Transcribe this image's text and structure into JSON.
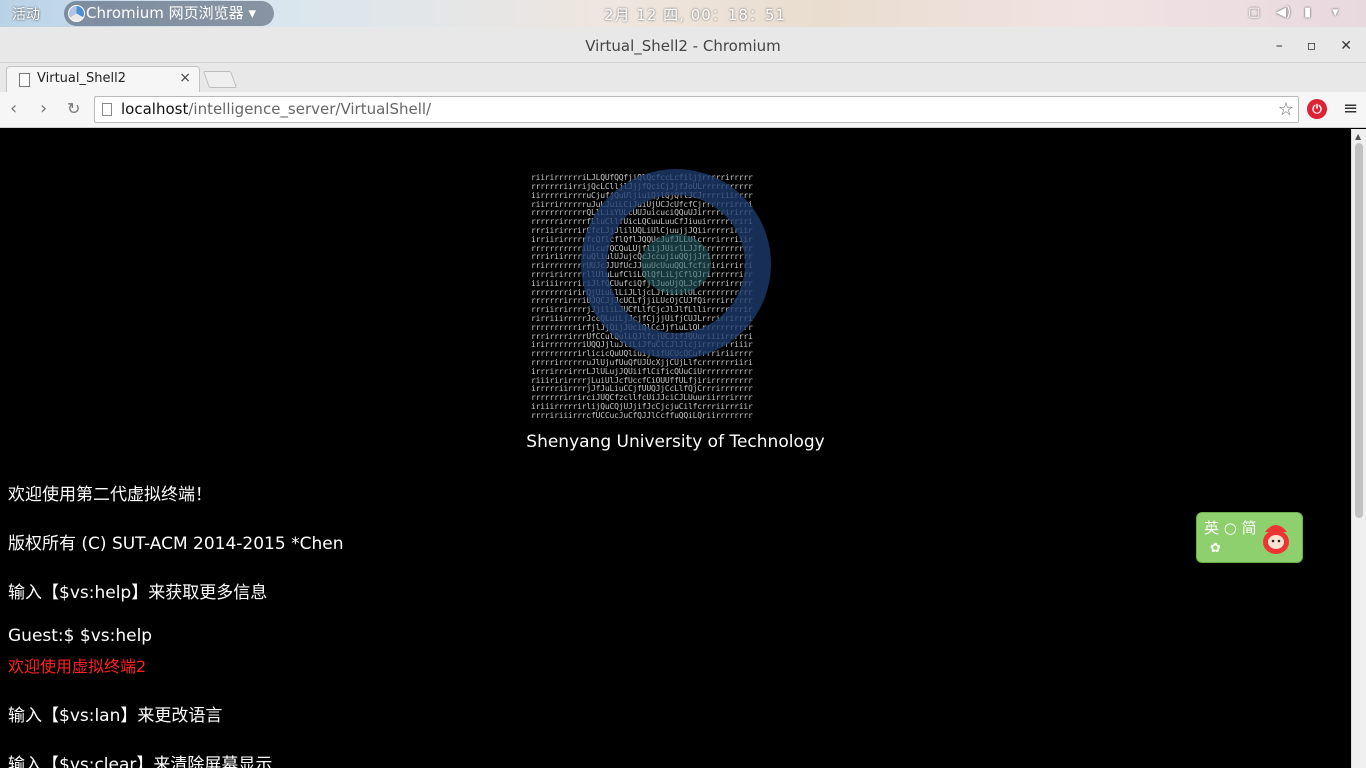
{
  "system_bar": {
    "activities": "活动",
    "app_menu": "Chromium 网页浏览器",
    "clock": "2月 12 四, 00：18：51"
  },
  "window": {
    "title": "Virtual_Shell2 - Chromium"
  },
  "tab": {
    "title": "Virtual_Shell2"
  },
  "address_bar": {
    "host": "localhost",
    "path": "/intelligence_server/VirtualShell/"
  },
  "page": {
    "university": "Shenyang University of Technology",
    "lines": [
      {
        "text": "欢迎使用第二代虚拟终端！",
        "color": "#ffffff"
      },
      {
        "text": "版权所有 (C) SUT-ACM 2014-2015 *Chen",
        "color": "#ffffff"
      },
      {
        "text": "输入【$vs:help】来获取更多信息",
        "color": "#ffffff"
      },
      {
        "text": "Guest:$  $vs:help",
        "color": "#ffffff"
      },
      {
        "text": "欢迎使用虚拟终端2",
        "color": "#ff2020"
      },
      {
        "text": "输入【$vs:lan】来更改语言",
        "color": "#ffffff"
      },
      {
        "text": "输入【$vs:clear】来清除屏幕显示",
        "color": "#ffffff"
      }
    ]
  },
  "ime": {
    "label": "英 ○ 简"
  },
  "icons": [
    "chromium-icon",
    "back-icon",
    "forward-icon",
    "reload-icon",
    "page-icon",
    "star-icon",
    "extension-icon",
    "menu-icon",
    "close-icon",
    "minimize-icon",
    "maximize-icon"
  ]
}
